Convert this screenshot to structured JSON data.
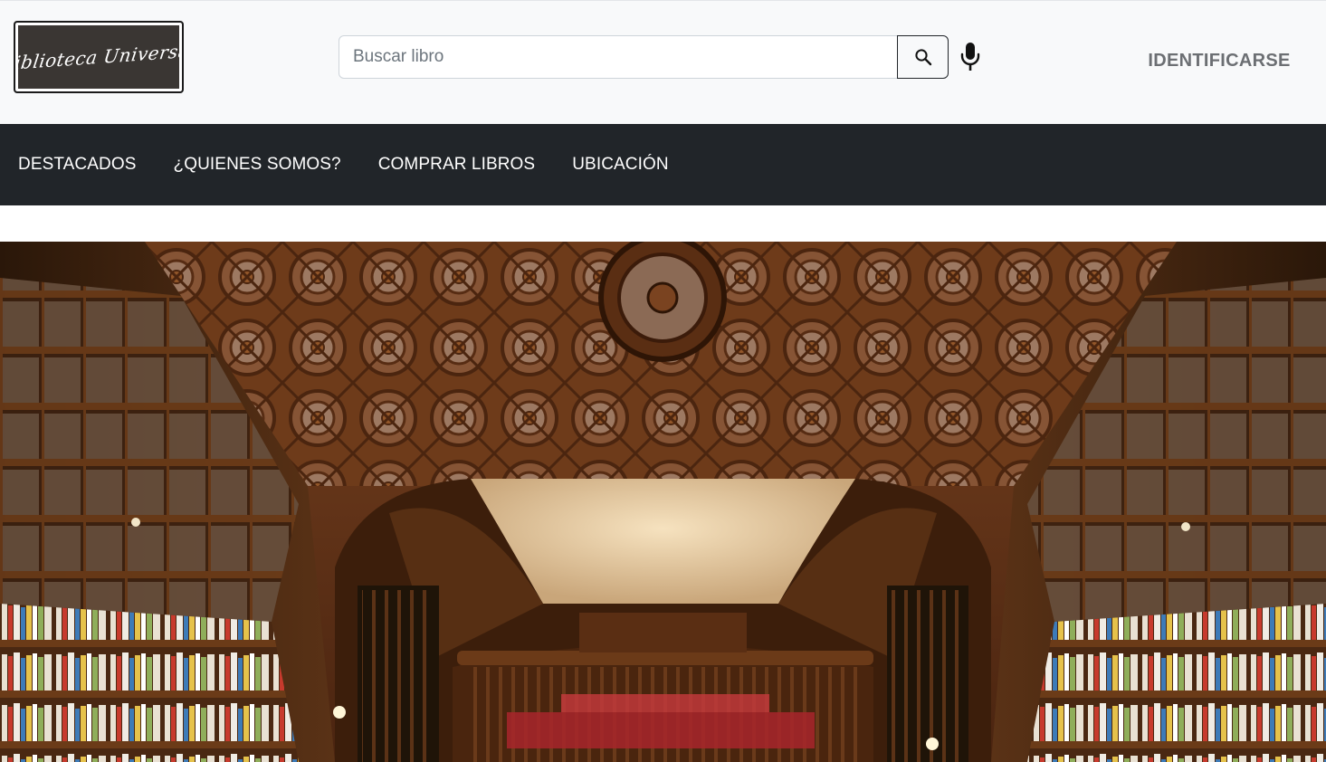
{
  "brand": {
    "logo_text": "Biblioteca Universal"
  },
  "search": {
    "placeholder": "Buscar libro",
    "value": ""
  },
  "header": {
    "login_label": "IDENTIFICARSE"
  },
  "nav": {
    "items": [
      {
        "label": "DESTACADOS"
      },
      {
        "label": "¿QUIENES SOMOS?"
      },
      {
        "label": "COMPRAR LIBROS"
      },
      {
        "label": "UBICACIÓN"
      }
    ]
  },
  "icons": {
    "search": "search-icon",
    "mic": "microphone-icon"
  },
  "colors": {
    "nav_bg": "#212529",
    "header_bg": "#f8f9fa",
    "logo_bg": "#3a3633",
    "login_text": "#6c6f73"
  }
}
